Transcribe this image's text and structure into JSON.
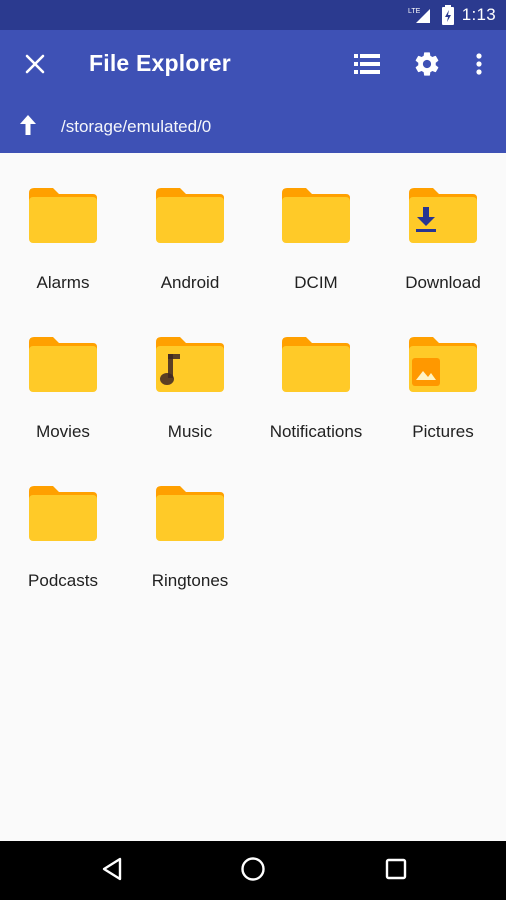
{
  "status_bar": {
    "network": "LTE",
    "time": "1:13"
  },
  "toolbar": {
    "title": "File Explorer",
    "icons": [
      "close-icon",
      "list-view-icon",
      "gear-icon",
      "more-vert-icon"
    ]
  },
  "path_bar": {
    "path": "/storage/emulated/0",
    "icon": "arrow-up-icon"
  },
  "folders": [
    {
      "name": "Alarms"
    },
    {
      "name": "Android"
    },
    {
      "name": "DCIM"
    },
    {
      "name": "Download",
      "badge": "download-icon"
    },
    {
      "name": "Movies"
    },
    {
      "name": "Music",
      "badge": "music-note-icon"
    },
    {
      "name": "Notifications"
    },
    {
      "name": "Pictures",
      "badge": "image-icon"
    },
    {
      "name": "Podcasts"
    },
    {
      "name": "Ringtones"
    }
  ],
  "navbar": {
    "icons": [
      "back-icon",
      "home-icon",
      "recents-icon"
    ]
  },
  "colors": {
    "toolbar": "#3e51b5",
    "status_bar": "#2b3a8f",
    "folder": "#ffca28",
    "folder_tab": "#ffa000",
    "badge_dark": "#283593",
    "badge_orange": "#ff9800"
  }
}
